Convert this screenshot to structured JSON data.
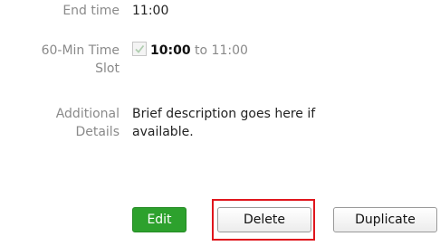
{
  "fields": {
    "end_time": {
      "label": "End time",
      "value": "11:00"
    },
    "time_slot": {
      "label_line1": "60-Min Time",
      "label_line2": "Slot",
      "checked": true,
      "start": "10:00",
      "connector": "to",
      "end": "11:00"
    },
    "additional_details": {
      "label_line1": "Additional",
      "label_line2": "Details",
      "value_line1": "Brief description goes here if",
      "value_line2": "available."
    }
  },
  "actions": {
    "edit_label": "Edit",
    "delete_label": "Delete",
    "duplicate_label": "Duplicate"
  },
  "colors": {
    "edit_button": "#2da12d",
    "highlight": "#e0161d",
    "label_text": "#8a8a8a"
  }
}
